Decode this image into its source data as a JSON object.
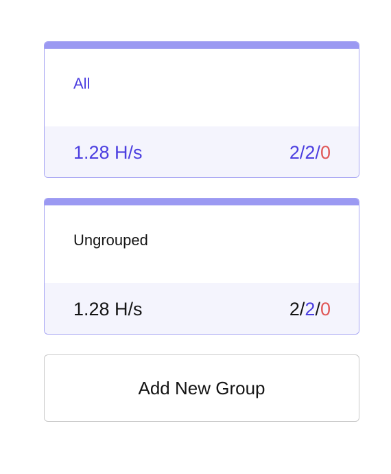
{
  "groups": [
    {
      "name": "All",
      "hashrate": "1.28 H/s",
      "counts": {
        "a": "2",
        "sep1": "/",
        "b": "2",
        "sep2": "/",
        "c": "0"
      }
    },
    {
      "name": "Ungrouped",
      "hashrate": "1.28 H/s",
      "counts": {
        "a": "2",
        "sep1": "/",
        "b": "2",
        "sep2": "/",
        "c": "0"
      }
    }
  ],
  "add_button_label": "Add New Group",
  "colors": {
    "accent": "#4b3ee0",
    "card_top_bar": "#9b99f2",
    "card_border": "#a5a3f3",
    "footer_bg": "#f4f4fd",
    "error_red": "#e05656",
    "text_dark": "#141414"
  }
}
